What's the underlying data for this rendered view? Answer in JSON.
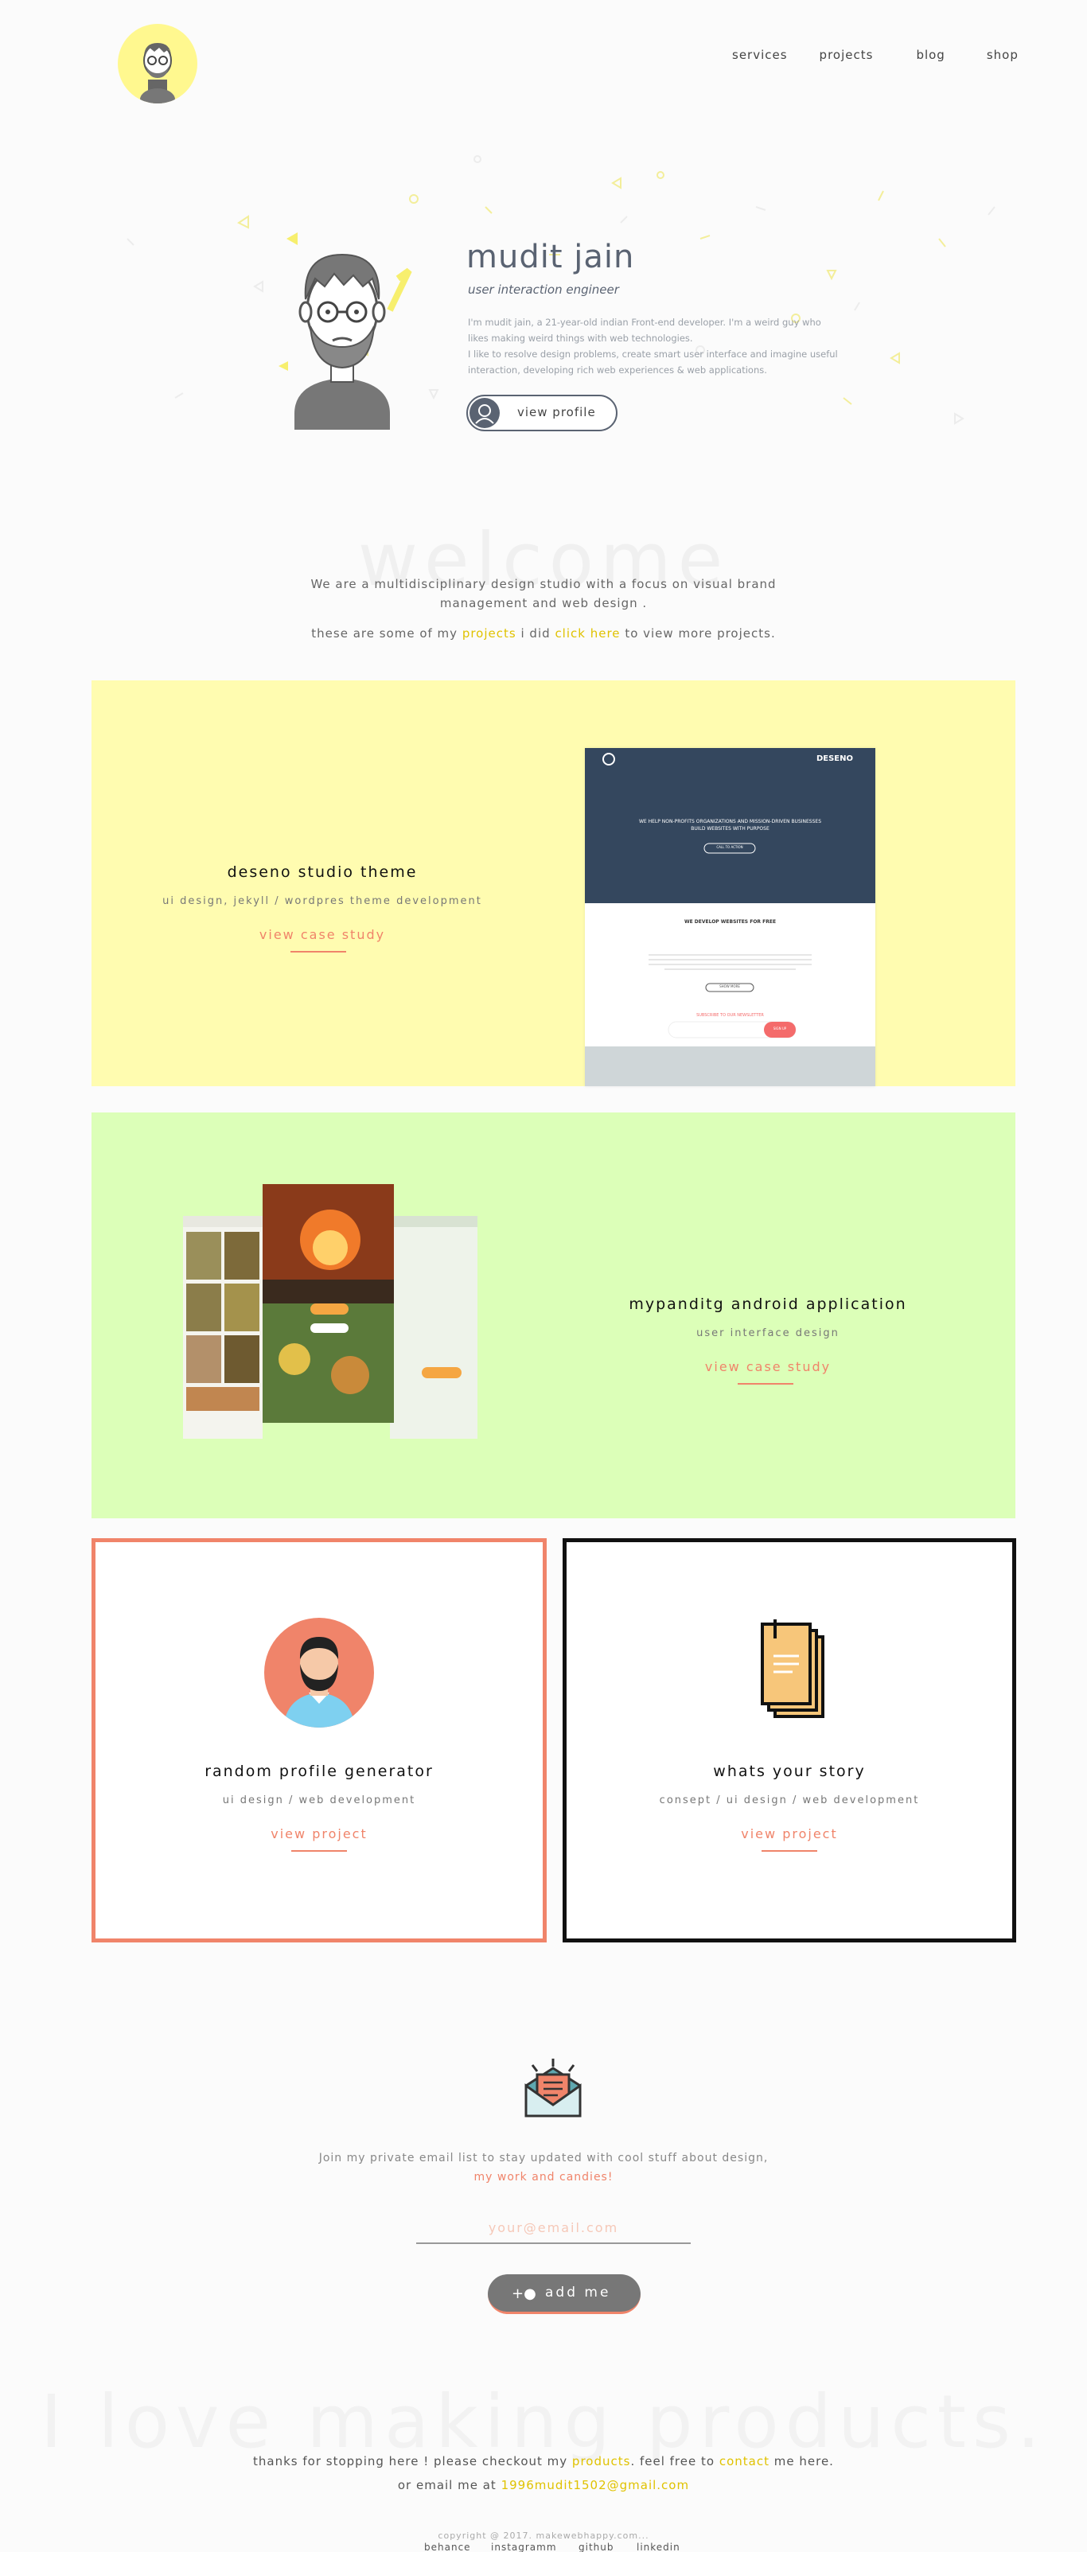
{
  "nav": {
    "items": [
      {
        "label": "services"
      },
      {
        "label": "projects"
      },
      {
        "label": "blog"
      },
      {
        "label": "shop"
      }
    ]
  },
  "hero": {
    "name": "mudit jain",
    "role": "user interaction engineer",
    "bio_line1": "I'm mudit jain, a 21-year-old indian Front-end developer. I'm a weird guy who likes making weird things with web technologies.",
    "bio_line2": "I like to resolve design problems, create smart user interface and imagine useful interaction, developing rich web experiences & web applications.",
    "button_label": "view profile"
  },
  "welcome": {
    "bg_text": "welcome",
    "intro": "We are a multidisciplinary design studio with a focus on visual brand management and web design .",
    "projects_prefix": "these are some of my",
    "projects_link": "projects",
    "projects_mid": "i did",
    "click_link": "click here",
    "projects_suffix": "to view more projects."
  },
  "projects": [
    {
      "title": "deseno studio theme",
      "subtitle": "ui design, jekyll / wordpres theme development",
      "link": "view case study",
      "bg": "#fffcb0"
    },
    {
      "title": "mypanditg android application",
      "subtitle": "user interface design",
      "link": "view case study",
      "bg": "#dcffb8"
    },
    {
      "title": "random profile generator",
      "subtitle": "ui design / web development",
      "link": "view project",
      "border": "#f0846a"
    },
    {
      "title": "whats your story",
      "subtitle": "consept / ui design / web development",
      "link": "view project",
      "border": "#111111"
    }
  ],
  "deseno_shot": {
    "brand": "DESENO",
    "headline": "WE HELP NON-PROFITS ORGANIZATIONS AND MISSION-DRIVEN BUSINESSES BUILD WEBSITES WITH PURPOSE",
    "cta": "CALL TO ACTION",
    "section": "WE DEVELOP WEBSITES FOR FREE",
    "more": "SHOW MORE",
    "newsletter": "SUBSCRIBE TO OUR NEWSLETTER",
    "signup": "SIGN UP"
  },
  "newsletter": {
    "line1": "Join my private email list to stay updated with cool stuff about design,",
    "line2": "my work and candies!",
    "placeholder": "your@email.com",
    "button_label": "add me"
  },
  "footer": {
    "bg_text": "I love making products.",
    "thanks_prefix": "thanks for stopping here ! please checkout my",
    "products_link": "products",
    "thanks_mid": ". feel free to",
    "contact_link": "contact",
    "thanks_suffix": "me here.",
    "email_prefix": "or email me at",
    "email": "1996mudit1502@gmail.com",
    "links": [
      {
        "label": "behance"
      },
      {
        "label": "instagramm"
      },
      {
        "label": "github"
      },
      {
        "label": "linkedin"
      }
    ],
    "copyright": "copyright @ 2017. makewebhappy.com..."
  },
  "colors": {
    "accent_yellow": "#e0c200",
    "accent_coral": "#f0846a",
    "slate": "#5a6372"
  }
}
